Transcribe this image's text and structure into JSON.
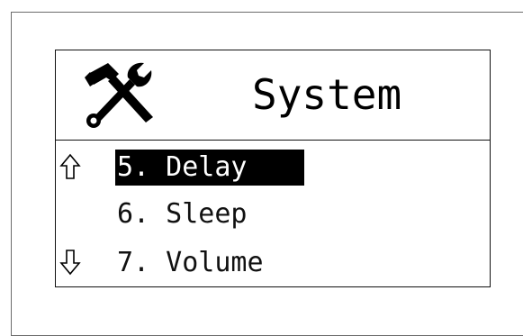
{
  "screen": {
    "title": "System",
    "header_icon": "tools-icon"
  },
  "menu": {
    "scroll_up_icon": "up-arrow-icon",
    "scroll_down_icon": "down-arrow-icon",
    "items": [
      {
        "label": "5. Delay",
        "selected": true
      },
      {
        "label": "6. Sleep",
        "selected": false
      },
      {
        "label": "7. Volume",
        "selected": false
      }
    ]
  },
  "colors": {
    "foreground": "#000000",
    "background": "#ffffff",
    "highlight_bg": "#000000",
    "highlight_fg": "#ffffff"
  }
}
